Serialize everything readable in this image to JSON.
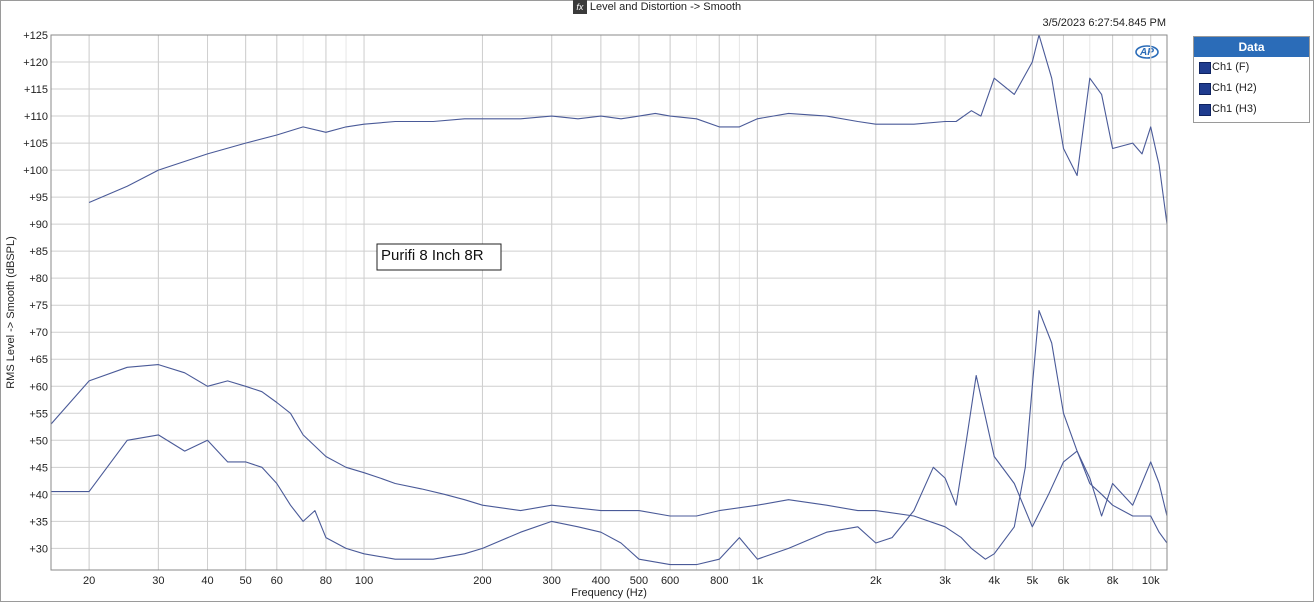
{
  "window": {
    "title": "Level and Distortion -> Smooth",
    "fx_label": "fx",
    "timestamp": "3/5/2023 6:27:54.845 PM",
    "logo_text": "AP"
  },
  "legend": {
    "title": "Data",
    "items": [
      "Ch1 (F)",
      "Ch1 (H2)",
      "Ch1 (H3)"
    ],
    "swatch_color": "#1f3c8f",
    "header_color": "#2b6cb8"
  },
  "chart_data": {
    "type": "line",
    "title": "Level and Distortion -> Smooth",
    "xlabel": "Frequency (Hz)",
    "ylabel": "RMS Level -> Smooth (dBSPL)",
    "xscale": "log",
    "xlim": [
      16,
      11000
    ],
    "ylim": [
      26,
      125
    ],
    "grid": true,
    "legend_position": "right",
    "line_color": "#4a5a98",
    "annotation": "Purifi 8 Inch 8R",
    "x_ticks": [
      20,
      30,
      40,
      50,
      60,
      80,
      100,
      200,
      300,
      400,
      500,
      600,
      800,
      1000,
      2000,
      3000,
      4000,
      5000,
      6000,
      8000,
      10000
    ],
    "x_tick_labels": [
      "20",
      "30",
      "40",
      "50",
      "60",
      "80",
      "100",
      "200",
      "300",
      "400",
      "500",
      "600",
      "800",
      "1k",
      "2k",
      "3k",
      "4k",
      "5k",
      "6k",
      "8k",
      "10k"
    ],
    "y_ticks": [
      30,
      35,
      40,
      45,
      50,
      55,
      60,
      65,
      70,
      75,
      80,
      85,
      90,
      95,
      100,
      105,
      110,
      115,
      120,
      125
    ],
    "y_tick_labels": [
      "+30",
      "+35",
      "+40",
      "+45",
      "+50",
      "+55",
      "+60",
      "+65",
      "+70",
      "+75",
      "+80",
      "+85",
      "+90",
      "+95",
      "+100",
      "+105",
      "+110",
      "+115",
      "+120",
      "+125"
    ],
    "series": [
      {
        "name": "Ch1 (F)",
        "x": [
          20,
          25,
          30,
          40,
          50,
          60,
          70,
          80,
          90,
          100,
          120,
          150,
          180,
          200,
          250,
          300,
          350,
          400,
          450,
          500,
          550,
          600,
          700,
          800,
          900,
          1000,
          1200,
          1500,
          1800,
          2000,
          2500,
          3000,
          3200,
          3500,
          3700,
          4000,
          4500,
          5000,
          5200,
          5600,
          6000,
          6500,
          7000,
          7500,
          8000,
          9000,
          9500,
          10000,
          10500,
          11000
        ],
        "y": [
          94,
          97,
          100,
          103,
          105,
          106.5,
          108,
          107,
          108,
          108.5,
          109,
          109,
          109.5,
          109.5,
          109.5,
          110,
          109.5,
          110,
          109.5,
          110,
          110.5,
          110,
          109.5,
          108,
          108,
          109.5,
          110.5,
          110,
          109,
          108.5,
          108.5,
          109,
          109,
          111,
          110,
          117,
          114,
          120,
          125,
          117,
          104,
          99,
          117,
          114,
          104,
          105,
          103,
          108,
          101,
          90
        ]
      },
      {
        "name": "Ch1 (H2)",
        "x": [
          16,
          20,
          25,
          30,
          35,
          40,
          45,
          50,
          55,
          60,
          65,
          70,
          80,
          90,
          100,
          110,
          120,
          140,
          160,
          180,
          200,
          250,
          300,
          400,
          500,
          600,
          700,
          800,
          1000,
          1200,
          1500,
          1800,
          2000,
          2500,
          3000,
          3300,
          3500,
          3800,
          4000,
          4500,
          4800,
          5000,
          5200,
          5600,
          6000,
          6500,
          7000,
          7500,
          8000,
          9000,
          10000,
          10500,
          11000
        ],
        "y": [
          53,
          61,
          63.5,
          64,
          62.5,
          60,
          61,
          60,
          59,
          57,
          55,
          51,
          47,
          45,
          44,
          43,
          42,
          41,
          40,
          39,
          38,
          37,
          38,
          37,
          37,
          36,
          36,
          37,
          38,
          39,
          38,
          37,
          37,
          36,
          34,
          32,
          30,
          28,
          29,
          34,
          45,
          60,
          74,
          68,
          55,
          48,
          42,
          40,
          38,
          36,
          36,
          33,
          31
        ]
      },
      {
        "name": "Ch1 (H3)",
        "x": [
          16,
          20,
          25,
          30,
          35,
          40,
          45,
          50,
          55,
          60,
          65,
          70,
          75,
          80,
          90,
          100,
          120,
          150,
          180,
          200,
          250,
          300,
          350,
          400,
          450,
          500,
          600,
          700,
          800,
          900,
          1000,
          1200,
          1500,
          1800,
          2000,
          2200,
          2500,
          2800,
          3000,
          3200,
          3400,
          3600,
          4000,
          4500,
          5000,
          5500,
          6000,
          6500,
          7000,
          7500,
          8000,
          9000,
          10000,
          10500,
          11000
        ],
        "y": [
          40.5,
          40.5,
          50,
          51,
          48,
          50,
          46,
          46,
          45,
          42,
          38,
          35,
          37,
          32,
          30,
          29,
          28,
          28,
          29,
          30,
          33,
          35,
          34,
          33,
          31,
          28,
          27,
          27,
          28,
          32,
          28,
          30,
          33,
          34,
          31,
          32,
          37,
          45,
          43,
          38,
          50,
          62,
          47,
          42,
          34,
          40,
          46,
          48,
          43,
          36,
          42,
          38,
          46,
          42,
          36
        ]
      }
    ]
  }
}
